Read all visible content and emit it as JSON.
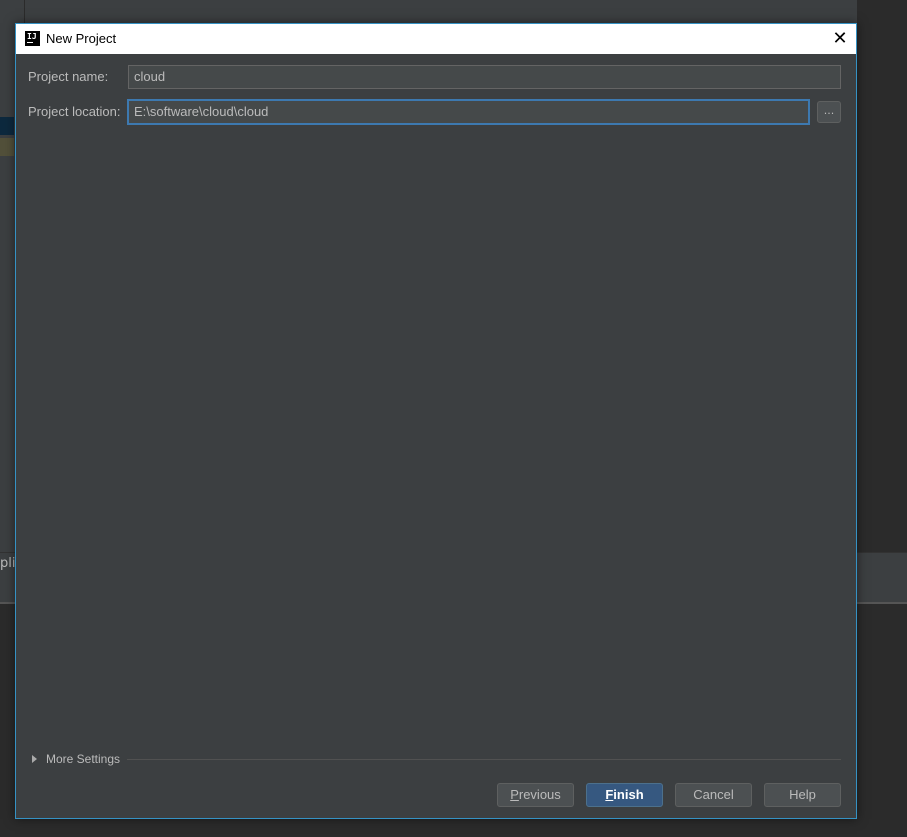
{
  "background": {
    "partial_text": "plic"
  },
  "dialog": {
    "title": "New Project",
    "fields": {
      "project_name": {
        "label": "Project name:",
        "value": "cloud"
      },
      "project_location": {
        "label": "Project location:",
        "value": "E:\\software\\cloud\\cloud"
      }
    },
    "browse_label": "...",
    "more_settings_label": "More Settings",
    "buttons": {
      "previous": {
        "mnemonic": "P",
        "rest": "revious"
      },
      "finish": {
        "mnemonic": "F",
        "rest": "inish"
      },
      "cancel": "Cancel",
      "help": "Help"
    }
  },
  "colors": {
    "dialog_bg": "#3c3f41",
    "field_bg": "#45494a",
    "focus_border": "#3d79b0",
    "primary_button": "#365880",
    "text": "#bbbbbb"
  }
}
